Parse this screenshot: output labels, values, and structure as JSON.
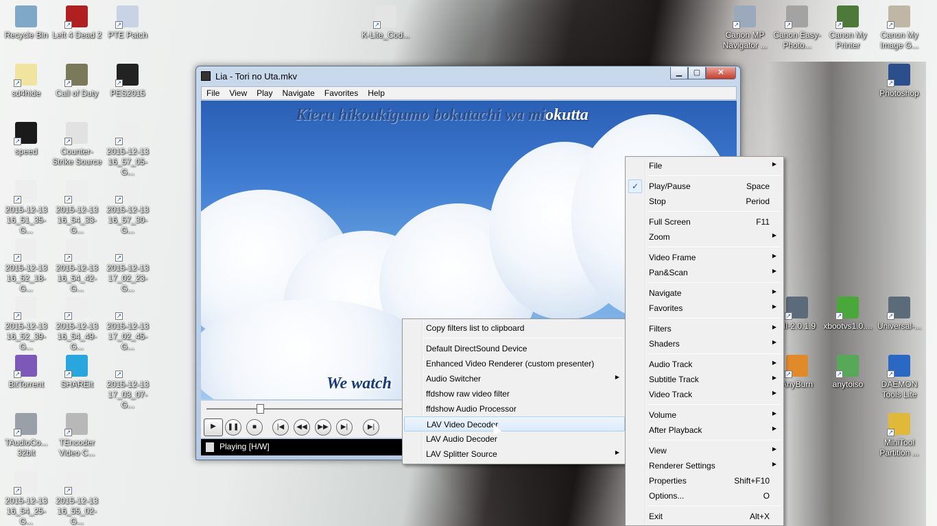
{
  "desktop_icons": [
    {
      "label": "Recycle Bin",
      "icon": "recycle-bin-icon",
      "color": "#7fa7c7"
    },
    {
      "label": "Left 4 Dead 2",
      "icon": "left4dead-icon",
      "color": "#b02020"
    },
    {
      "label": "PTE Patch",
      "icon": "pte-patch-icon",
      "color": "#c9d3e6"
    },
    {
      "label": "K-Lite_Cod...",
      "icon": "klite-codec-icon",
      "color": "#e4e4e4"
    },
    {
      "label": "Canon MP Navigator ...",
      "icon": "canon-mp-navigator-icon",
      "color": "#9aa9bb"
    },
    {
      "label": "Canon Easy-Photo...",
      "icon": "canon-easy-photo-icon",
      "color": "#a3a3a3"
    },
    {
      "label": "Canon My Printer",
      "icon": "canon-printer-icon",
      "color": "#4d7a3a"
    },
    {
      "label": "Canon My Image G...",
      "icon": "canon-image-icon",
      "color": "#c0b6a6"
    },
    {
      "label": "sd4hide",
      "icon": "skull-icon",
      "color": "#f1e4a0"
    },
    {
      "label": "Call of Duty",
      "icon": "call-of-duty-icon",
      "color": "#7a7a5a"
    },
    {
      "label": "PES2015",
      "icon": "pes2015-icon",
      "color": "#222222"
    },
    {
      "label": "Photoshop",
      "icon": "photoshop-icon",
      "color": "#2a4f8c"
    },
    {
      "label": "speed",
      "icon": "nfs-speed-icon",
      "color": "#1a1a1a"
    },
    {
      "label": "Counter-Strike Source",
      "icon": "counter-strike-icon",
      "color": "#e2e2e2"
    },
    {
      "label": "2015-12-13 16_57_05-G...",
      "icon": "screenshot-file-icon",
      "color": "#eeeeee"
    },
    {
      "label": "2015-12-13 16_51_35-G...",
      "icon": "screenshot-file-icon",
      "color": "#eeeeee"
    },
    {
      "label": "2015-12-13 16_54_33-G...",
      "icon": "screenshot-file-icon",
      "color": "#eeeeee"
    },
    {
      "label": "2015-12-13 16_57_30-G...",
      "icon": "screenshot-file-icon",
      "color": "#eeeeee"
    },
    {
      "label": "2015-12-13 16_52_18-G...",
      "icon": "screenshot-file-icon",
      "color": "#eeeeee"
    },
    {
      "label": "2015-12-13 16_54_42-G...",
      "icon": "screenshot-file-icon",
      "color": "#eeeeee"
    },
    {
      "label": "2015-12-13 17_02_23-G...",
      "icon": "screenshot-file-icon",
      "color": "#eeeeee"
    },
    {
      "label": "2015-12-13 16_52_39-G...",
      "icon": "screenshot-file-icon",
      "color": "#eeeeee"
    },
    {
      "label": "2015-12-13 16_54_49-G...",
      "icon": "screenshot-file-icon",
      "color": "#eeeeee"
    },
    {
      "label": "2015-12-13 17_02_45-G...",
      "icon": "screenshot-file-icon",
      "color": "#eeeeee"
    },
    {
      "label": "BitTorrent",
      "icon": "bittorrent-icon",
      "color": "#7d58b8"
    },
    {
      "label": "SHAREit",
      "icon": "shareit-icon",
      "color": "#2aa6df"
    },
    {
      "label": "2015-12-13 17_03_07-G...",
      "icon": "screenshot-file-icon",
      "color": "#eeeeee"
    },
    {
      "label": "TAudioCo... 32bit",
      "icon": "taudioconverter-icon",
      "color": "#9aa0a8"
    },
    {
      "label": "TEncoder Video C...",
      "icon": "tencoder-icon",
      "color": "#b8b8b8"
    },
    {
      "label": "2015-12-13 16_54_25-G...",
      "icon": "screenshot-file-icon",
      "color": "#eeeeee"
    },
    {
      "label": "2015-12-13 16_55_02-G...",
      "icon": "screenshot-file-icon",
      "color": "#eeeeee"
    },
    {
      "label": "MI-2.0.1.9",
      "icon": "mi-computer-icon",
      "color": "#5c6b7a"
    },
    {
      "label": "xbootvs1.0....",
      "icon": "xboot-icon",
      "color": "#4aa83a"
    },
    {
      "label": "Universal-...",
      "icon": "universal-usb-icon",
      "color": "#5c6b7a"
    },
    {
      "label": "AnyBurn",
      "icon": "anyburn-icon",
      "color": "#e08a2a"
    },
    {
      "label": "anytoiso",
      "icon": "anytoiso-icon",
      "color": "#58a85a"
    },
    {
      "label": "DAEMON Tools Lite",
      "icon": "daemon-tools-icon",
      "color": "#2b68c4"
    },
    {
      "label": "MiniTool Partition ...",
      "icon": "minitool-partition-icon",
      "color": "#e0b83a"
    }
  ],
  "player": {
    "title": "Lia - Tori no Uta.mkv",
    "menu": [
      "File",
      "View",
      "Play",
      "Navigate",
      "Favorites",
      "Help"
    ],
    "lyric_top_unsung": "Kieru hikoukigumo bokutachi wa mi",
    "lyric_top_sung": "okutta",
    "lyric_bottom": "We watch",
    "seek_position": 0.27,
    "controls": [
      "play-icon",
      "pause-icon",
      "stop-icon",
      "skip-back-icon",
      "rewind-icon",
      "fast-forward-icon",
      "skip-forward-icon",
      "frame-step-icon"
    ],
    "status": "Playing [H/W]",
    "minimize": "▁",
    "maximize": "▢",
    "close": "✕"
  },
  "main_menu": [
    {
      "label": "File",
      "submenu": true
    },
    {
      "sep": true
    },
    {
      "label": "Play/Pause",
      "accel": "Space",
      "checked": true
    },
    {
      "label": "Stop",
      "accel": "Period"
    },
    {
      "sep": true
    },
    {
      "label": "Full Screen",
      "accel": "F11"
    },
    {
      "label": "Zoom",
      "submenu": true
    },
    {
      "sep": true
    },
    {
      "label": "Video Frame",
      "submenu": true
    },
    {
      "label": "Pan&Scan",
      "submenu": true
    },
    {
      "sep": true
    },
    {
      "label": "Navigate",
      "submenu": true
    },
    {
      "label": "Favorites",
      "submenu": true
    },
    {
      "sep": true
    },
    {
      "label": "Filters",
      "submenu": true,
      "open": true
    },
    {
      "label": "Shaders",
      "submenu": true
    },
    {
      "sep": true
    },
    {
      "label": "Audio Track",
      "submenu": true
    },
    {
      "label": "Subtitle Track",
      "submenu": true
    },
    {
      "label": "Video Track",
      "submenu": true
    },
    {
      "sep": true
    },
    {
      "label": "Volume",
      "submenu": true
    },
    {
      "label": "After Playback",
      "submenu": true
    },
    {
      "sep": true
    },
    {
      "label": "View",
      "submenu": true
    },
    {
      "label": "Renderer Settings",
      "submenu": true
    },
    {
      "label": "Properties",
      "accel": "Shift+F10"
    },
    {
      "label": "Options...",
      "accel": "O"
    },
    {
      "sep": true
    },
    {
      "label": "Exit",
      "accel": "Alt+X"
    }
  ],
  "filters_menu": [
    {
      "label": "Copy filters list to clipboard"
    },
    {
      "sep": true
    },
    {
      "label": "Default DirectSound Device"
    },
    {
      "label": "Enhanced Video Renderer (custom presenter)"
    },
    {
      "label": "Audio Switcher",
      "submenu": true
    },
    {
      "label": "ffdshow raw video filter"
    },
    {
      "label": "ffdshow Audio Processor"
    },
    {
      "label": "LAV Video Decoder",
      "hover": true
    },
    {
      "label": "LAV Audio Decoder"
    },
    {
      "label": "LAV Splitter Source",
      "submenu": true
    }
  ],
  "glyphs": {
    "check": "✓",
    "submenu_arrow": "▶",
    "shortcut_arrow": "↗"
  }
}
